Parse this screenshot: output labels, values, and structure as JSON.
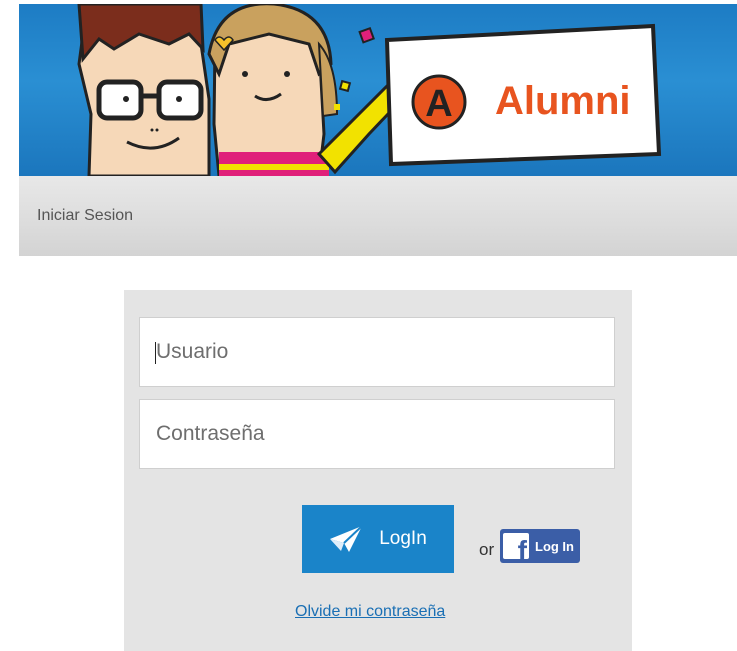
{
  "header": {
    "brand_text": "Alumni"
  },
  "breadcrumb": {
    "label": "Iniciar Sesion"
  },
  "login": {
    "username_placeholder": "Usuario",
    "password_placeholder": "Contraseña",
    "login_button_label": "LogIn",
    "or_text": "or",
    "facebook_button_label": "Log In",
    "forgot_password_link": "Olvide mi contraseña"
  },
  "icons": {
    "login_button_icon": "paper-plane-icon",
    "facebook_icon": "facebook-f-icon"
  },
  "colors": {
    "banner_blue": "#1d7cc4",
    "login_button": "#1a84c9",
    "facebook_button": "#3b5ea7",
    "link": "#1a6fb4",
    "brand_text": "#e8541f"
  }
}
